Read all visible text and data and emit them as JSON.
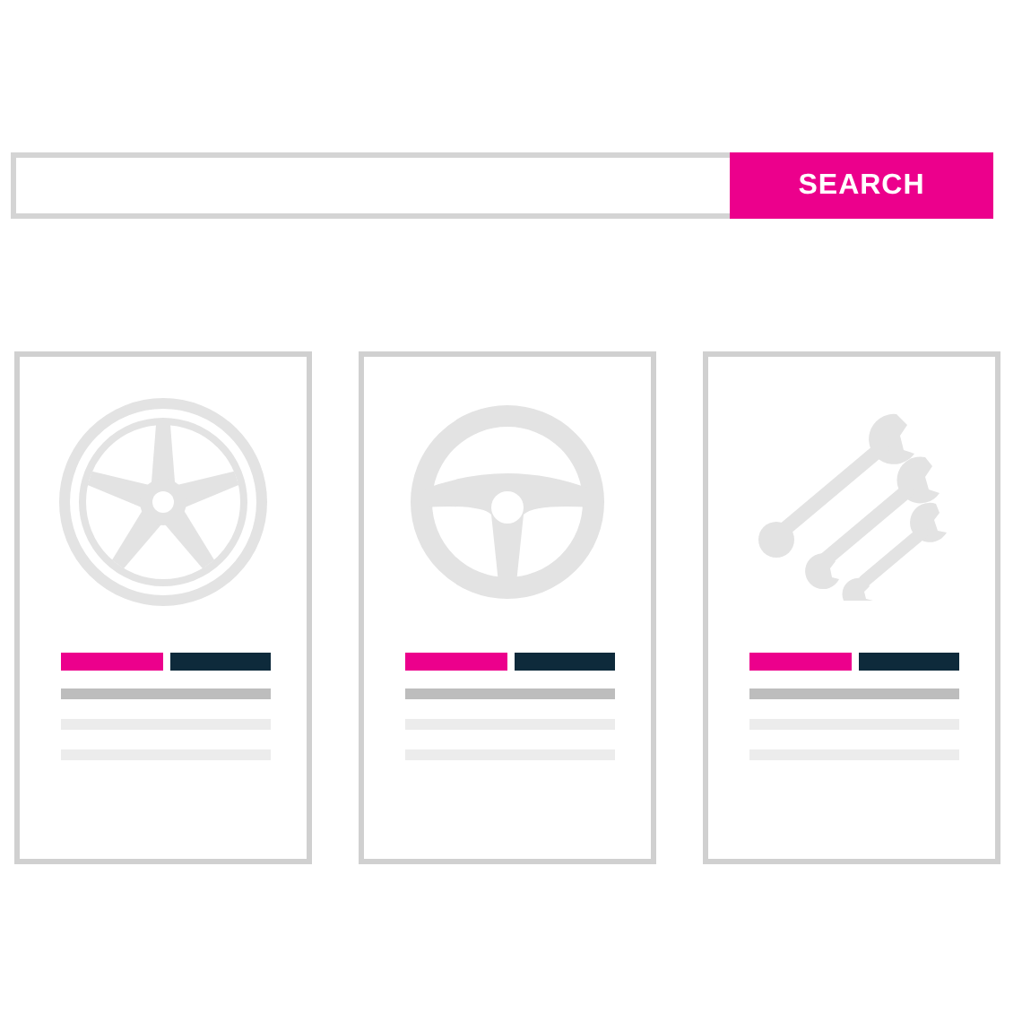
{
  "search": {
    "button": "SEARCH"
  },
  "cards": [
    {
      "kind": "wheel"
    },
    {
      "kind": "steering"
    },
    {
      "kind": "wrenches"
    }
  ]
}
